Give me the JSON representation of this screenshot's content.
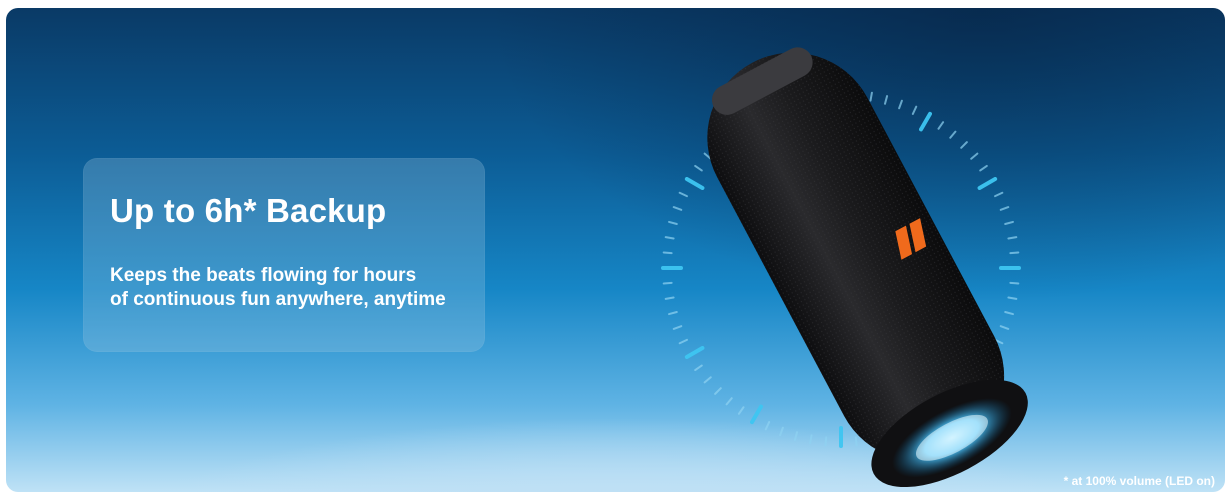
{
  "banner": {
    "headline": "Up to 6h* Backup",
    "subtitle_line1": "Keeps the beats flowing for hours",
    "subtitle_line2": "of continuous fun anywhere, anytime",
    "footnote": "* at 100% volume (LED on)"
  },
  "product": {
    "icon": "portable-bluetooth-speaker",
    "logo_icon": "brand-logo-icon"
  },
  "colors": {
    "background_top": "#0a3a66",
    "background_bottom": "#bfe2f6",
    "tick_accent": "#3ec6f2",
    "speaker_body": "#1c1c1e",
    "logo_orange": "#f06a1c",
    "ring_glow": "#4fc3f7"
  }
}
